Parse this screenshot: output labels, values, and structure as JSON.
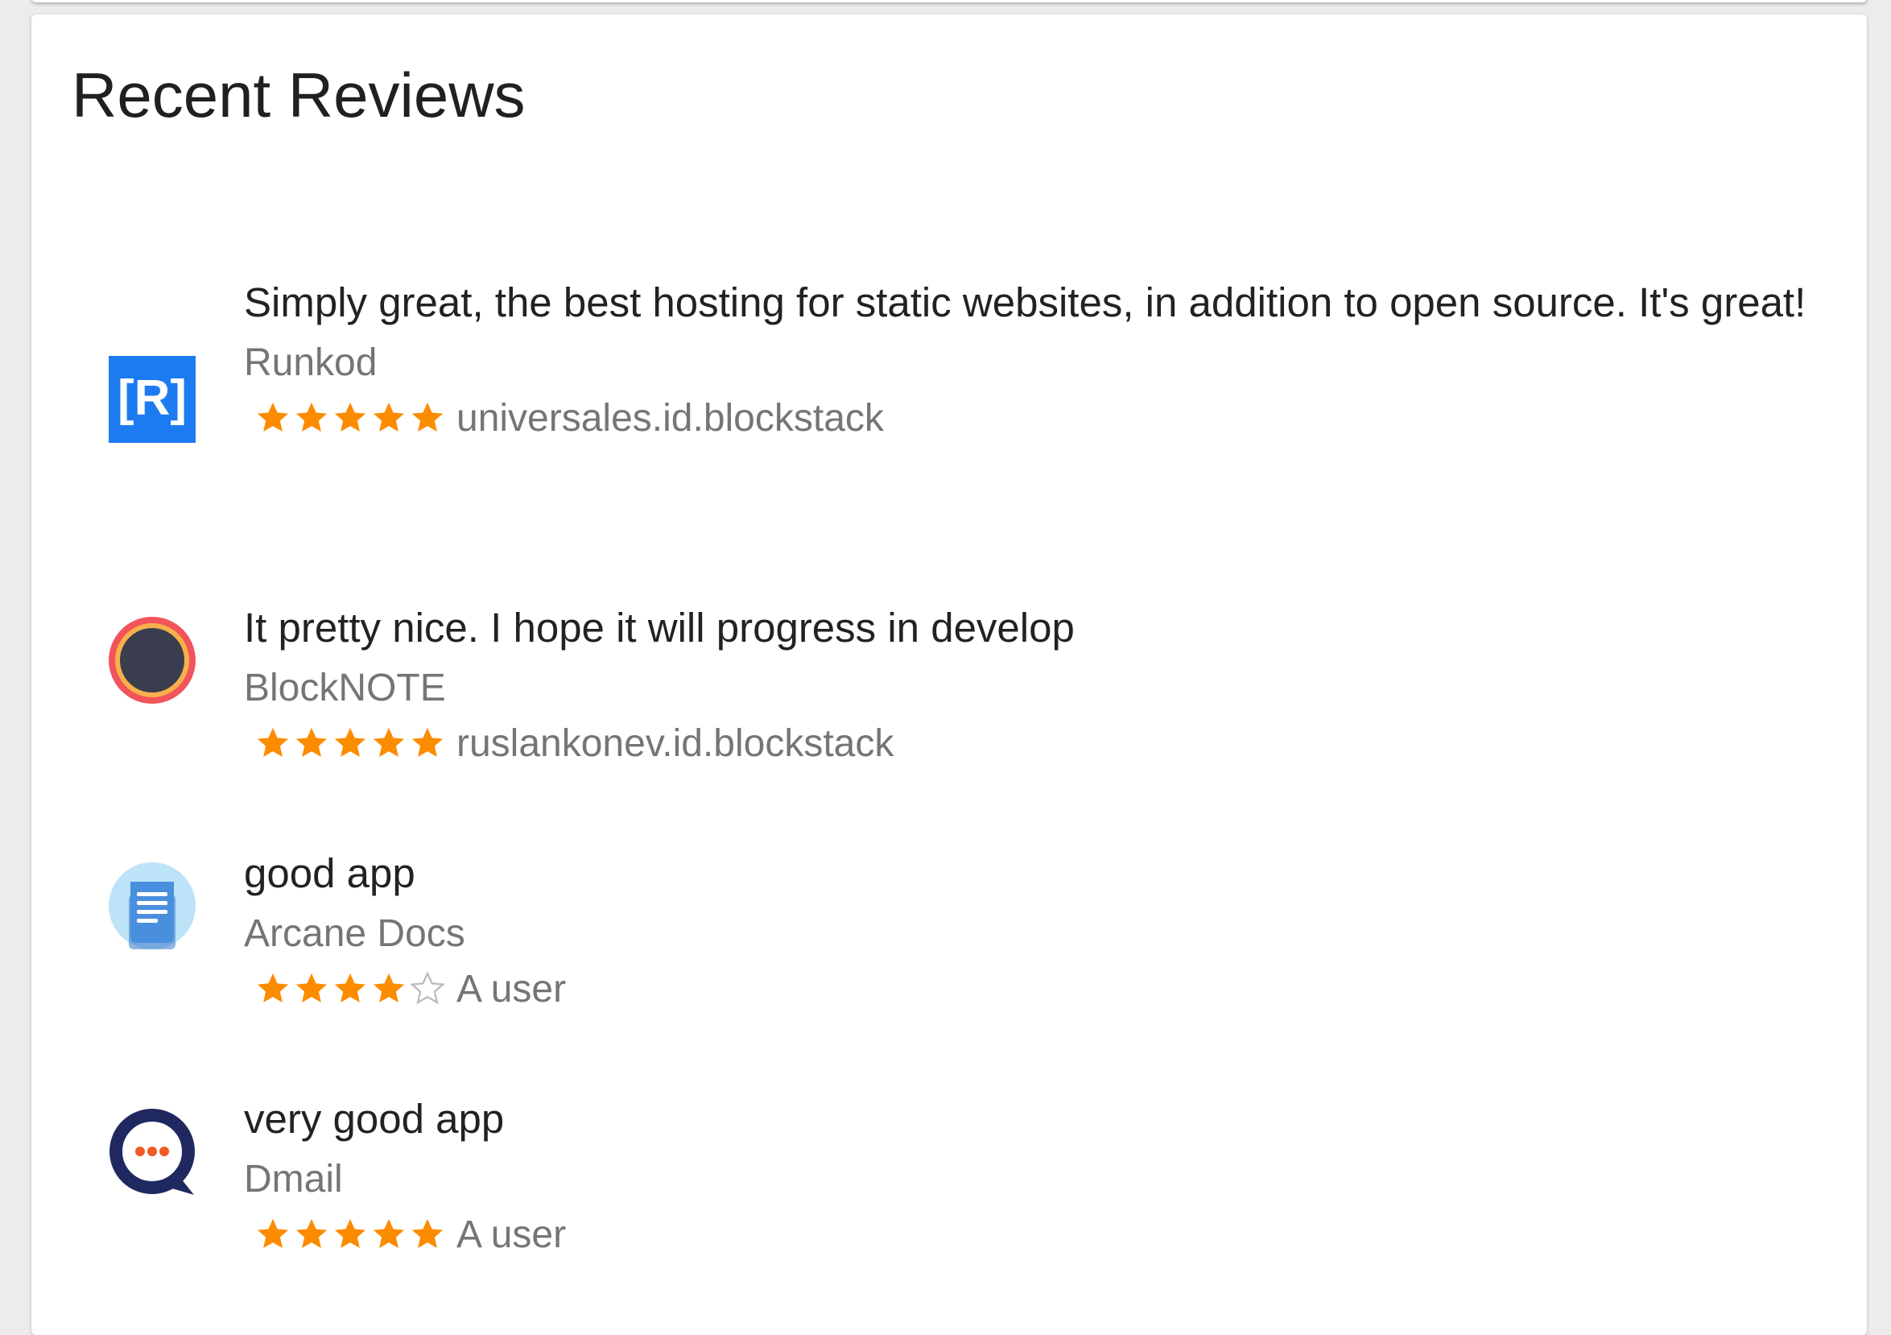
{
  "section": {
    "title": "Recent Reviews"
  },
  "colors": {
    "star_filled": "#FB8C00",
    "star_empty": "#BDBDBD",
    "runkod_blue": "#1C7BF0",
    "blocknote_ring": "#F2545B",
    "blocknote_inner_ring": "#F8B04A",
    "blocknote_core": "#3A3D4E",
    "arcane_bg": "#BDE3F8",
    "arcane_doc": "#4A8FDE",
    "dmail_navy": "#1F2960",
    "dmail_dots": "#F15A24"
  },
  "reviews": [
    {
      "comment": "Simply great, the best hosting for static websites, in addition to open source. It's great!",
      "app": "Runkod",
      "icon": "runkod-logo-icon",
      "icon_text": "[R]",
      "rating": 5,
      "max_rating": 5,
      "reviewer": "universales.id.blockstack"
    },
    {
      "comment": "It pretty nice. I hope it will progress in develop",
      "app": "BlockNOTE",
      "icon": "blocknote-logo-icon",
      "rating": 5,
      "max_rating": 5,
      "reviewer": "ruslankonev.id.blockstack"
    },
    {
      "comment": "good app",
      "app": "Arcane Docs",
      "icon": "arcane-docs-logo-icon",
      "rating": 4,
      "max_rating": 5,
      "reviewer": "A user"
    },
    {
      "comment": "very good app",
      "app": "Dmail",
      "icon": "dmail-logo-icon",
      "rating": 5,
      "max_rating": 5,
      "reviewer": "A user"
    }
  ]
}
